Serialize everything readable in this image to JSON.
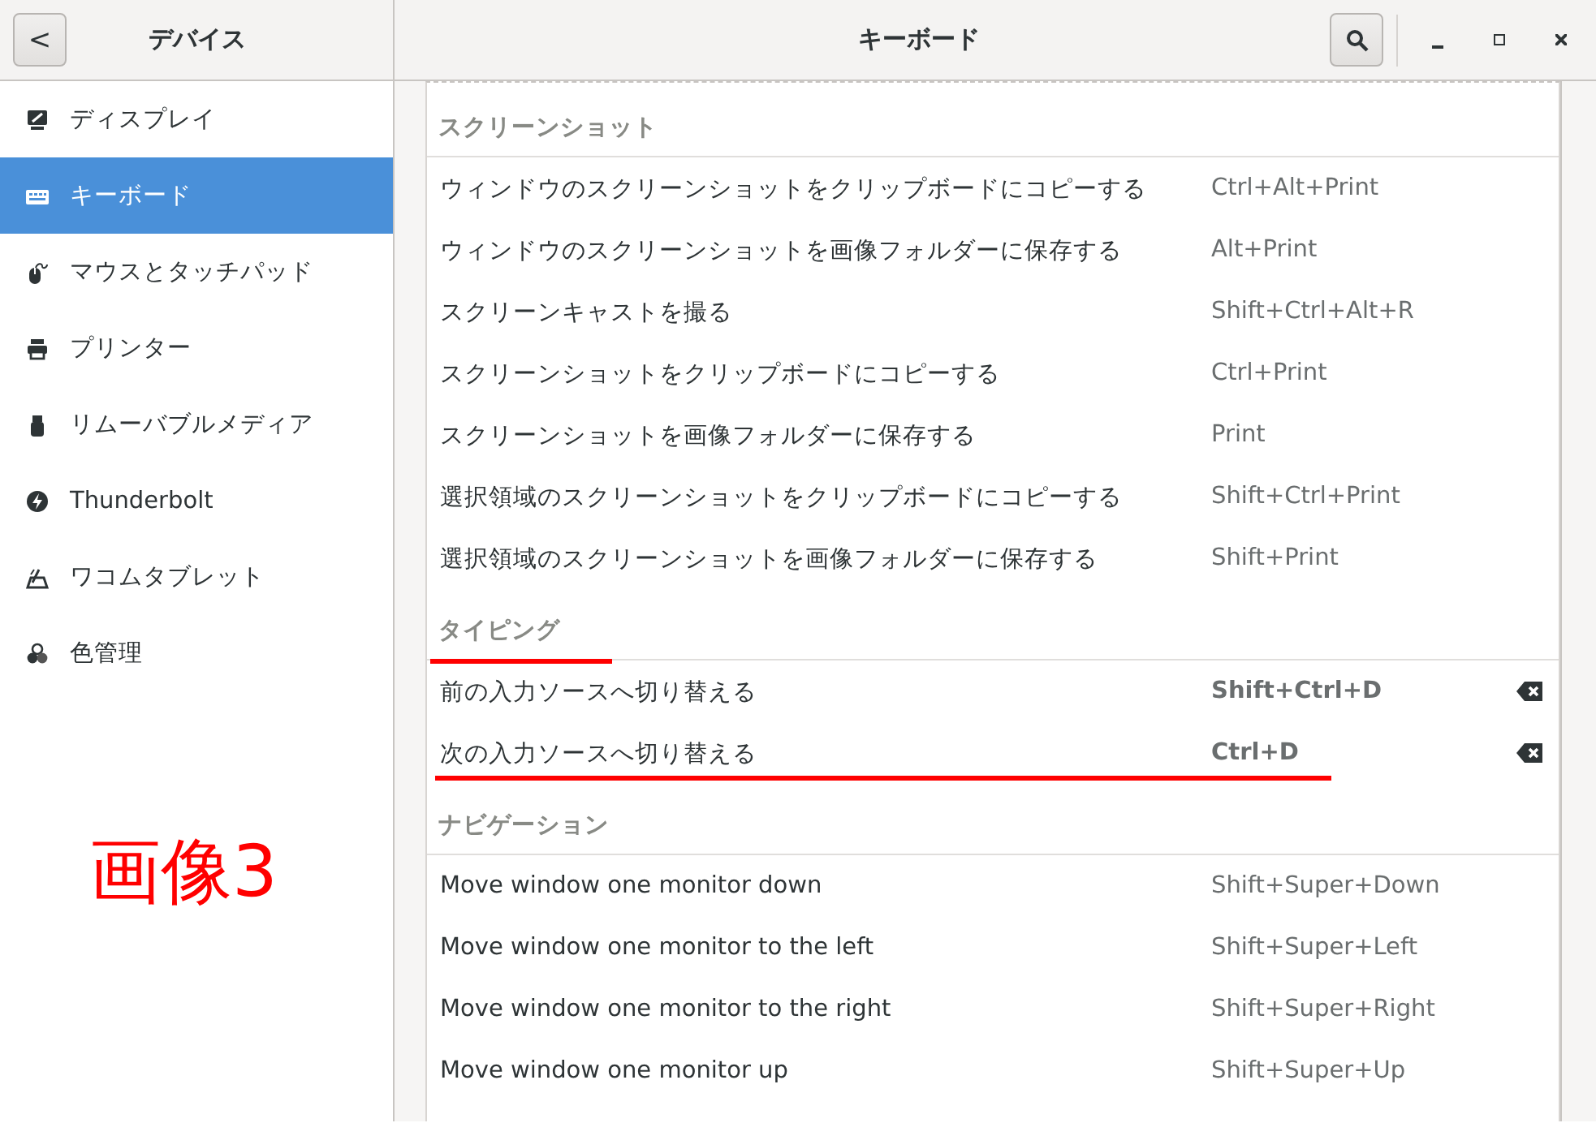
{
  "header": {
    "back_button": "<",
    "sidebar_title": "デバイス",
    "title": "キーボード"
  },
  "sidebar": {
    "items": [
      {
        "label": "ディスプレイ",
        "selected": false
      },
      {
        "label": "キーボード",
        "selected": true
      },
      {
        "label": "マウスとタッチパッド",
        "selected": false
      },
      {
        "label": "プリンター",
        "selected": false
      },
      {
        "label": "リムーバブルメディア",
        "selected": false
      },
      {
        "label": "Thunderbolt",
        "selected": false
      },
      {
        "label": "ワコムタブレット",
        "selected": false
      },
      {
        "label": "色管理",
        "selected": false
      }
    ]
  },
  "annotation": {
    "text": "画像3"
  },
  "sections": [
    {
      "title": "スクリーンショット",
      "underlined": false,
      "rows": [
        {
          "action": "ウィンドウのスクリーンショットをクリップボードにコピーする",
          "shortcut": "Ctrl+Alt+Print",
          "modified": false,
          "underlined": false
        },
        {
          "action": "ウィンドウのスクリーンショットを画像フォルダーに保存する",
          "shortcut": "Alt+Print",
          "modified": false,
          "underlined": false
        },
        {
          "action": "スクリーンキャストを撮る",
          "shortcut": "Shift+Ctrl+Alt+R",
          "modified": false,
          "underlined": false
        },
        {
          "action": "スクリーンショットをクリップボードにコピーする",
          "shortcut": "Ctrl+Print",
          "modified": false,
          "underlined": false
        },
        {
          "action": "スクリーンショットを画像フォルダーに保存する",
          "shortcut": "Print",
          "modified": false,
          "underlined": false
        },
        {
          "action": "選択領域のスクリーンショットをクリップボードにコピーする",
          "shortcut": "Shift+Ctrl+Print",
          "modified": false,
          "underlined": false
        },
        {
          "action": "選択領域のスクリーンショットを画像フォルダーに保存する",
          "shortcut": "Shift+Print",
          "modified": false,
          "underlined": false
        }
      ]
    },
    {
      "title": "タイピング",
      "underlined": true,
      "rows": [
        {
          "action": "前の入力ソースへ切り替える",
          "shortcut": "Shift+Ctrl+D",
          "modified": true,
          "underlined": false
        },
        {
          "action": "次の入力ソースへ切り替える",
          "shortcut": "Ctrl+D",
          "modified": true,
          "underlined": true
        }
      ]
    },
    {
      "title": "ナビゲーション",
      "underlined": false,
      "rows": [
        {
          "action": "Move window one monitor down",
          "shortcut": "Shift+Super+Down",
          "modified": false,
          "underlined": false
        },
        {
          "action": "Move window one monitor to the left",
          "shortcut": "Shift+Super+Left",
          "modified": false,
          "underlined": false
        },
        {
          "action": "Move window one monitor to the right",
          "shortcut": "Shift+Super+Right",
          "modified": false,
          "underlined": false
        },
        {
          "action": "Move window one monitor up",
          "shortcut": "Shift+Super+Up",
          "modified": false,
          "underlined": false
        }
      ]
    }
  ]
}
